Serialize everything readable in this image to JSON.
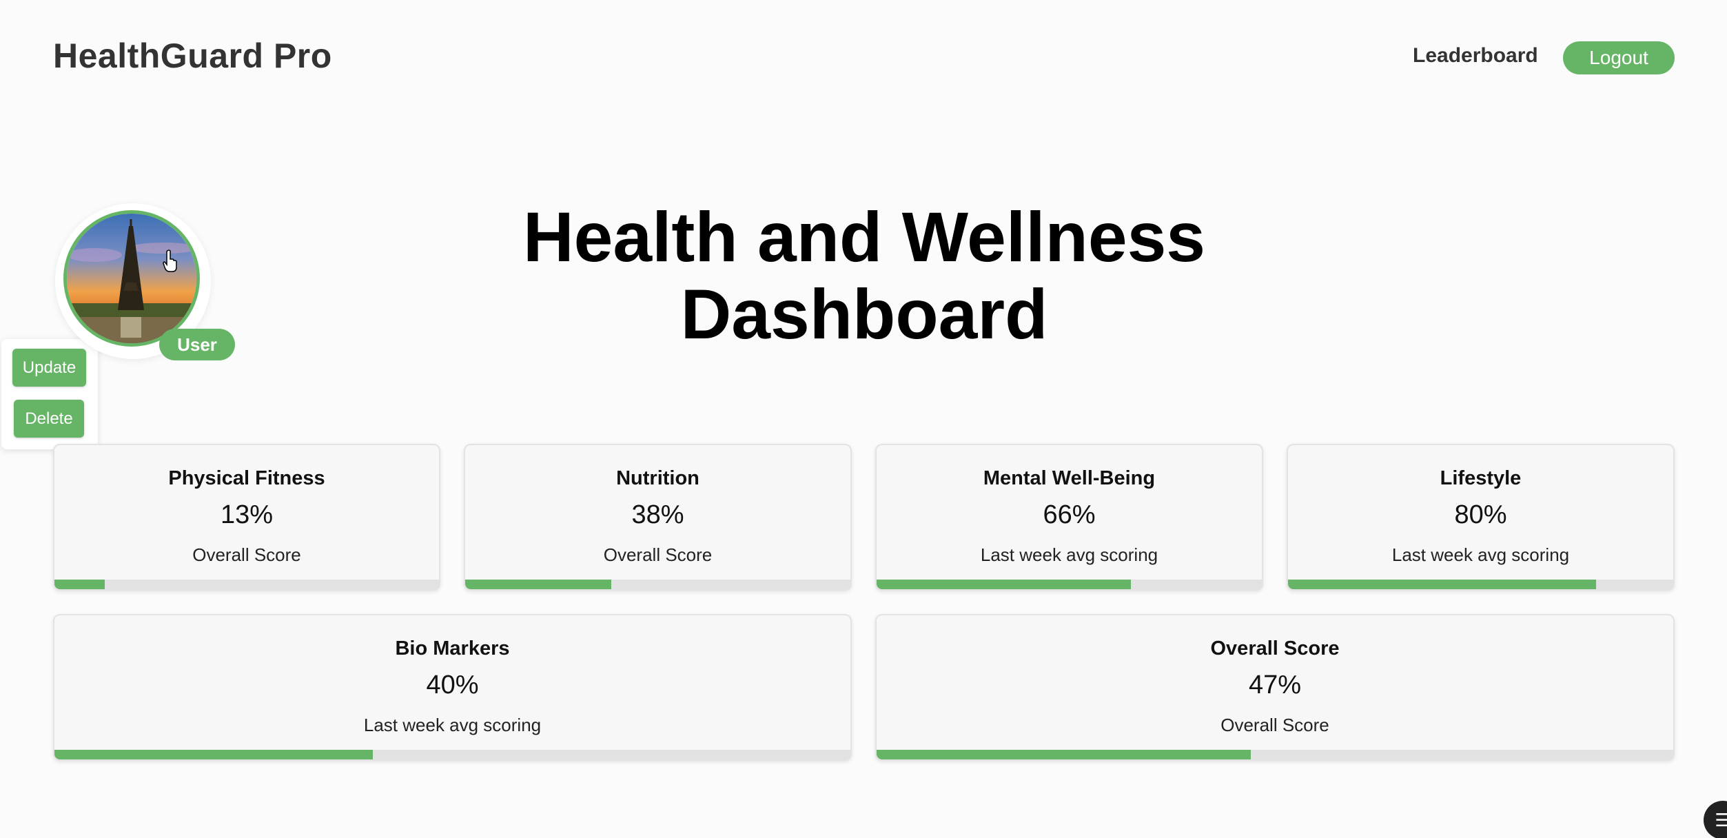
{
  "header": {
    "brand": "HealthGuard Pro",
    "leaderboard_label": "Leaderboard",
    "logout_label": "Logout"
  },
  "profile": {
    "role_label": "User",
    "update_label": "Update",
    "delete_label": "Delete",
    "avatar_image": "eiffel-tower-sunset-photo"
  },
  "main": {
    "title": "Health and Wellness Dashboard"
  },
  "cards": [
    {
      "title": "Physical Fitness",
      "value": "13%",
      "subtitle": "Overall Score",
      "progress": 13
    },
    {
      "title": "Nutrition",
      "value": "38%",
      "subtitle": "Overall Score",
      "progress": 38
    },
    {
      "title": "Mental Well-Being",
      "value": "66%",
      "subtitle": "Last week avg scoring",
      "progress": 66
    },
    {
      "title": "Lifestyle",
      "value": "80%",
      "subtitle": "Last week avg scoring",
      "progress": 80
    },
    {
      "title": "Bio Markers",
      "value": "40%",
      "subtitle": "Last week avg scoring",
      "progress": 40
    },
    {
      "title": "Overall Score",
      "value": "47%",
      "subtitle": "Overall Score",
      "progress": 47
    }
  ],
  "colors": {
    "accent": "#66b566",
    "track": "#e2e2e2",
    "card_bg": "#f7f7f7",
    "page_bg": "#fbfbfb"
  },
  "icons": {
    "cursor": "hand-pointer-icon",
    "corner": "settings-widget-icon"
  }
}
